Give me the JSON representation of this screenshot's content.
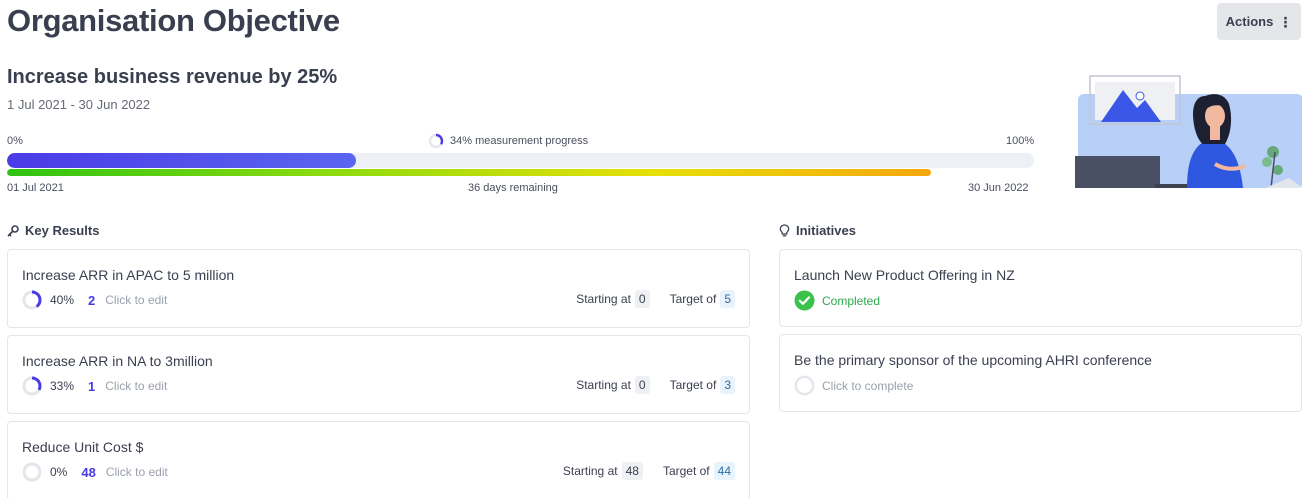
{
  "header": {
    "title": "Organisation Objective",
    "actions_label": "Actions"
  },
  "objective": {
    "title": "Increase business revenue by 25%",
    "dates": "1 Jul 2021 - 30 Jun 2022",
    "progress_min": "0%",
    "progress_max": "100%",
    "progress_label": "34% measurement progress",
    "progress_value": 0.34,
    "time_elapsed": 0.9,
    "start_date": "01 Jul 2021",
    "end_date": "30 Jun 2022",
    "remaining": "36 days remaining",
    "colors": {
      "accent": "#4a3be6",
      "time_start": "#2fc213",
      "time_end": "#f5a70d"
    }
  },
  "key_results": {
    "title": "Key Results",
    "icon": "key-icon",
    "items": [
      {
        "title": "Increase ARR in APAC to 5 million",
        "percent": "40%",
        "progress": 0.4,
        "current": "2",
        "edit": "Click to edit",
        "starting_label": "Starting at",
        "starting": "0",
        "target_label": "Target of",
        "target": "5"
      },
      {
        "title": "Increase ARR in NA to 3million",
        "percent": "33%",
        "progress": 0.33,
        "current": "1",
        "edit": "Click to edit",
        "starting_label": "Starting at",
        "starting": "0",
        "target_label": "Target of",
        "target": "3"
      },
      {
        "title": "Reduce Unit Cost $",
        "percent": "0%",
        "progress": 0,
        "current": "48",
        "edit": "Click to edit",
        "starting_label": "Starting at",
        "starting": "48",
        "target_label": "Target of",
        "target": "44"
      }
    ]
  },
  "initiatives": {
    "title": "Initiatives",
    "icon": "lightbulb-icon",
    "items": [
      {
        "title": "Launch New Product Offering in NZ",
        "status": "Completed",
        "icon": "check-circle-icon"
      },
      {
        "title": "Be the primary sponsor of the upcoming AHRI conference",
        "status": "Click to complete",
        "icon": "empty-circle-icon"
      }
    ]
  }
}
